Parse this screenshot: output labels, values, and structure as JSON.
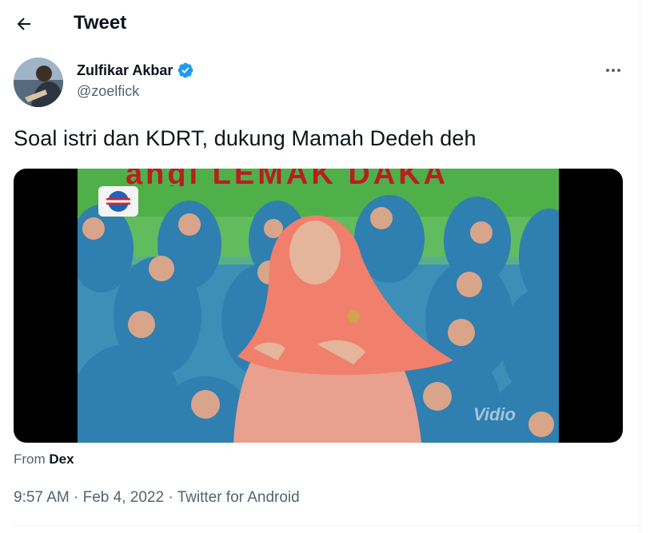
{
  "header": {
    "title": "Tweet",
    "back_icon": "arrow-left-icon"
  },
  "author": {
    "name": "Zulfikar Akbar",
    "handle": "@zoelfick",
    "verified": true,
    "verified_color": "#1d9bf0"
  },
  "tweet": {
    "text": "Soal istri dan KDRT, dukung Mamah Dedeh deh",
    "media": {
      "sign_text": "angi LEMAK DAKA",
      "watermark": "Vidio"
    }
  },
  "source": {
    "prefix": "From",
    "name": "Dex"
  },
  "meta": {
    "time": "9:57 AM",
    "separator": "·",
    "date": "Feb 4, 2022",
    "client": "Twitter for Android"
  },
  "colors": {
    "text": "#0f1419",
    "secondary": "#536471",
    "accent": "#1d9bf0"
  }
}
